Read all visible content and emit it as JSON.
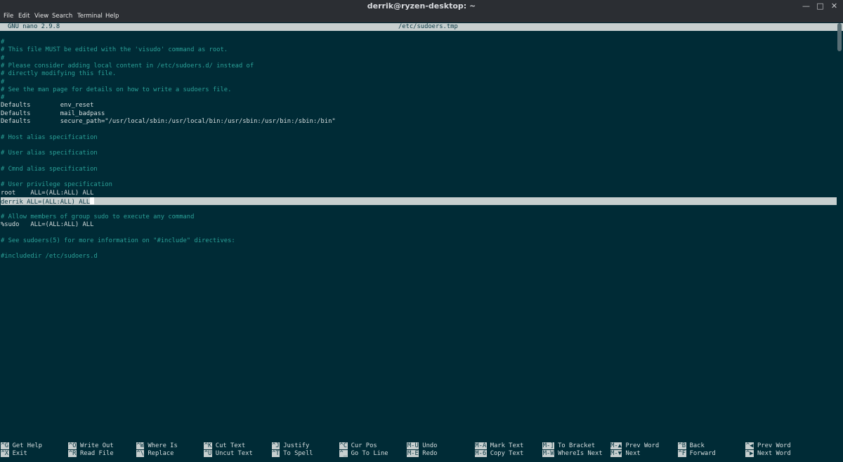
{
  "window": {
    "title": "derrik@ryzen-desktop: ~",
    "minimize_glyph": "—",
    "maximize_glyph": "□",
    "close_glyph": "✕"
  },
  "menu": [
    "File",
    "Edit",
    "View",
    "Search",
    "Terminal",
    "Help"
  ],
  "nano": {
    "version": "GNU nano 2.9.8",
    "filename": "/etc/sudoers.tmp"
  },
  "editor": {
    "lines": [
      "#",
      "# This file MUST be edited with the 'visudo' command as root.",
      "#",
      "# Please consider adding local content in /etc/sudoers.d/ instead of",
      "# directly modifying this file.",
      "#",
      "# See the man page for details on how to write a sudoers file.",
      "#",
      "Defaults        env_reset",
      "Defaults        mail_badpass",
      "Defaults        secure_path=\"/usr/local/sbin:/usr/local/bin:/usr/sbin:/usr/bin:/sbin:/bin\"",
      "",
      "# Host alias specification",
      "",
      "# User alias specification",
      "",
      "# Cmnd alias specification",
      "",
      "# User privilege specification",
      "root    ALL=(ALL:ALL) ALL",
      "derrik ALL=(ALL:ALL) ALL",
      "",
      "# Allow members of group sudo to execute any command",
      "%sudo   ALL=(ALL:ALL) ALL",
      "",
      "# See sudoers(5) for more information on \"#include\" directives:",
      "",
      "#includedir /etc/sudoers.d"
    ],
    "current_line": 20
  },
  "shortcuts": [
    [
      {
        "key": "^G",
        "label": "Get Help"
      },
      {
        "key": "^X",
        "label": "Exit"
      }
    ],
    [
      {
        "key": "^O",
        "label": "Write Out"
      },
      {
        "key": "^R",
        "label": "Read File"
      }
    ],
    [
      {
        "key": "^W",
        "label": "Where Is"
      },
      {
        "key": "^\\",
        "label": "Replace"
      }
    ],
    [
      {
        "key": "^K",
        "label": "Cut Text"
      },
      {
        "key": "^U",
        "label": "Uncut Text"
      }
    ],
    [
      {
        "key": "^J",
        "label": "Justify"
      },
      {
        "key": "^T",
        "label": "To Spell"
      }
    ],
    [
      {
        "key": "^C",
        "label": "Cur Pos"
      },
      {
        "key": "^_",
        "label": "Go To Line"
      }
    ],
    [
      {
        "key": "M-U",
        "label": "Undo"
      },
      {
        "key": "M-E",
        "label": "Redo"
      }
    ],
    [
      {
        "key": "M-A",
        "label": "Mark Text"
      },
      {
        "key": "M-6",
        "label": "Copy Text"
      }
    ],
    [
      {
        "key": "M-]",
        "label": "To Bracket"
      },
      {
        "key": "M-W",
        "label": "WhereIs Next"
      }
    ],
    [
      {
        "key": "M-▲",
        "label": "Prev Word"
      },
      {
        "key": "M-▼",
        "label": "Next"
      }
    ],
    [
      {
        "key": "^B",
        "label": "Back"
      },
      {
        "key": "^F",
        "label": "Forward"
      }
    ],
    [
      {
        "key": "^◀",
        "label": "Prev Word"
      },
      {
        "key": "^▶",
        "label": "Next Word"
      }
    ]
  ],
  "colors": {
    "background": "#002b36",
    "comment": "#2aa198",
    "text": "#d7dfe0",
    "highlight": "#c7cfcf"
  }
}
